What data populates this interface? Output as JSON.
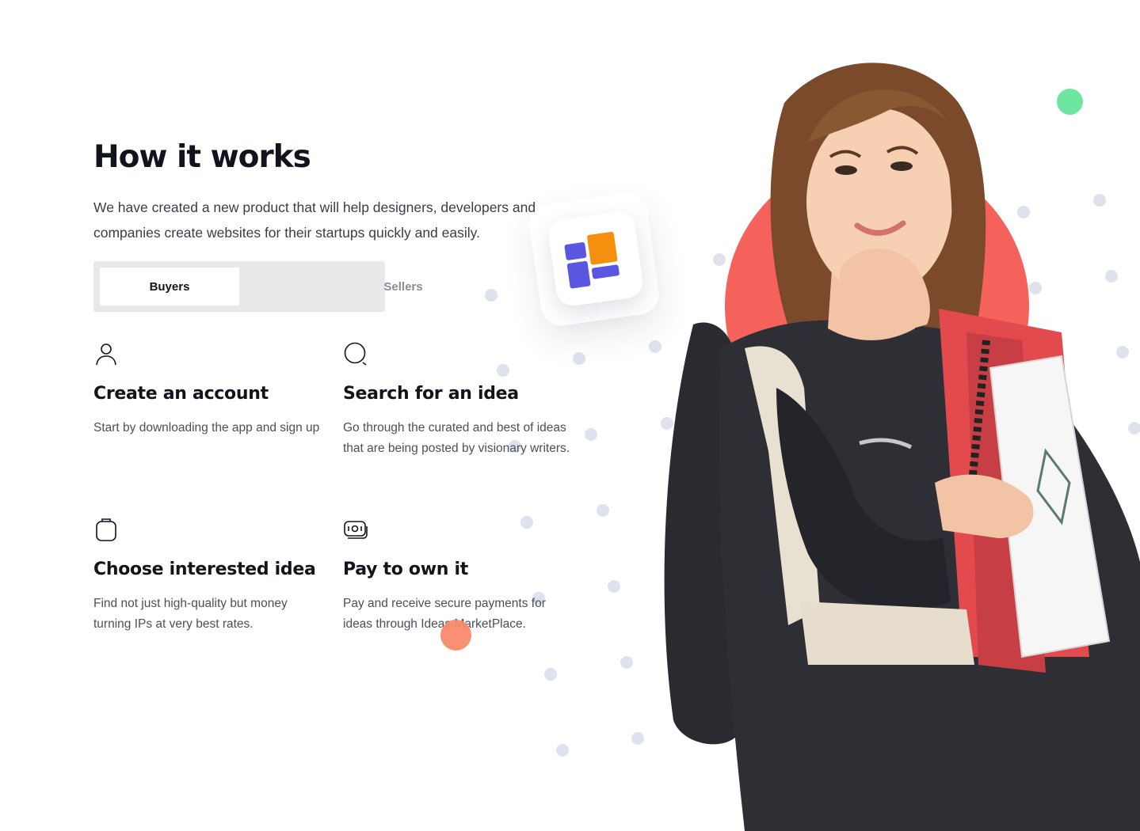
{
  "section": {
    "title": "How it works",
    "intro": "We have created a new product that will help designers, developers and companies create websites for their startups quickly and easily."
  },
  "tabs": [
    {
      "label": "Buyers",
      "active": true
    },
    {
      "label": "Sellers",
      "active": false
    }
  ],
  "steps": [
    {
      "icon": "user-icon",
      "title": "Create an account",
      "description": "Start by downloading the app and sign up"
    },
    {
      "icon": "search-icon",
      "title": "Search for an idea",
      "description": "Go through the curated and best of ideas that are being posted by visionary writers."
    },
    {
      "icon": "clipboard-icon",
      "title": "Choose interested idea",
      "description": "Find not just high-quality but money turning IPs at very best rates."
    },
    {
      "icon": "money-icon",
      "title": "Pay to own it",
      "description": "Pay and receive secure payments for ideas through Ideas MarketPlace."
    }
  ],
  "colors": {
    "hero_circle": "#f5615b",
    "accent_green": "#6ee5a1",
    "accent_orange": "#fa8a6a",
    "app_blue": "#5a56e0",
    "app_orange": "#f5900f"
  },
  "decor": {
    "app_badge_icon": "layout-grid-icon",
    "hero_image": "student-holding-notebooks"
  }
}
